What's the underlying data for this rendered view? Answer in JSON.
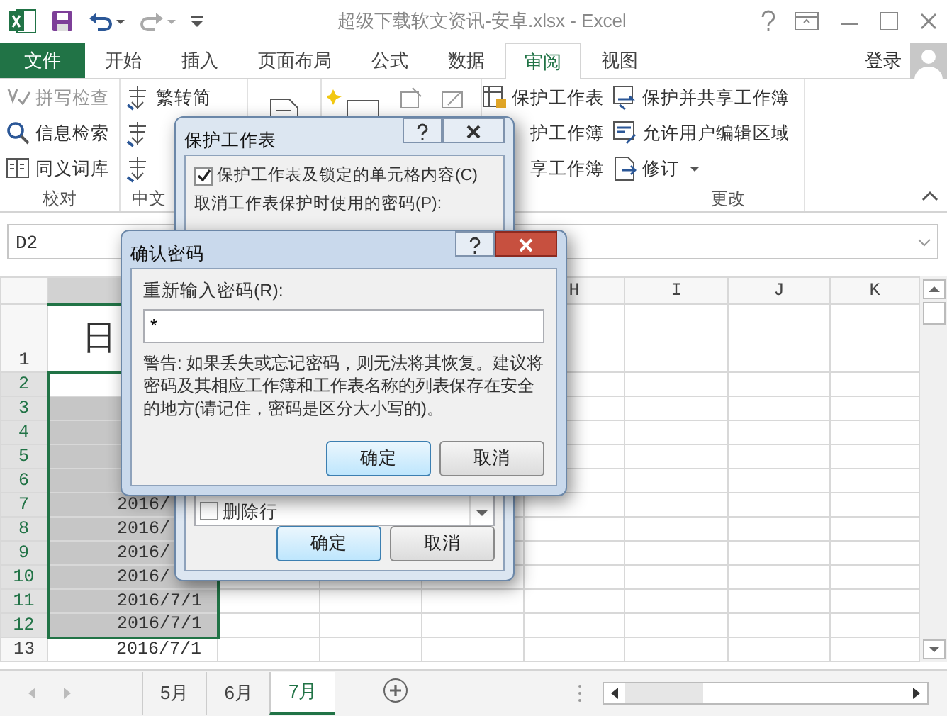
{
  "window": {
    "title": "超级下载软文资讯-安卓.xlsx - Excel"
  },
  "ribbon_tabs": [
    {
      "label": "文件",
      "kind": "file",
      "selected": false
    },
    {
      "label": "开始",
      "kind": "tab",
      "selected": false
    },
    {
      "label": "插入",
      "kind": "tab",
      "selected": false
    },
    {
      "label": "页面布局",
      "kind": "tab",
      "selected": false
    },
    {
      "label": "公式",
      "kind": "tab",
      "selected": false
    },
    {
      "label": "数据",
      "kind": "tab",
      "selected": false
    },
    {
      "label": "审阅",
      "kind": "tab",
      "selected": true
    },
    {
      "label": "视图",
      "kind": "tab",
      "selected": false
    }
  ],
  "account": {
    "label": "登录"
  },
  "ribbon_groups": [
    {
      "label": "校对",
      "items": [
        {
          "label": "拼写检查",
          "disabled": true
        },
        {
          "label": "信息检索",
          "disabled": false
        },
        {
          "label": "同义词库",
          "disabled": false
        }
      ]
    },
    {
      "label": "中文",
      "items": [
        {
          "label": "繁转简",
          "disabled": false
        }
      ]
    },
    {
      "label": "更改",
      "items": [
        {
          "label": "保护工作表",
          "disabled": false
        },
        {
          "label": "护工作簿",
          "disabled": false
        },
        {
          "label": "享工作簿",
          "disabled": false
        },
        {
          "label": "保护并共享工作簿",
          "disabled": false
        },
        {
          "label": "允许用户编辑区域",
          "disabled": false
        },
        {
          "label": "修订",
          "disabled": false
        }
      ]
    }
  ],
  "name_box": {
    "value": "D2"
  },
  "grid": {
    "columns": [
      {
        "label": "H"
      },
      {
        "label": "I"
      },
      {
        "label": "J"
      },
      {
        "label": "K"
      }
    ],
    "rows": [
      {
        "number": "1",
        "selected": false,
        "active": false,
        "cell": "日"
      },
      {
        "number": "2",
        "selected": true,
        "active": true
      },
      {
        "number": "3",
        "selected": true,
        "active": false
      },
      {
        "number": "4",
        "selected": true,
        "active": false
      },
      {
        "number": "5",
        "selected": true,
        "active": false
      },
      {
        "number": "6",
        "selected": true,
        "active": false
      },
      {
        "number": "7",
        "selected": true,
        "active": false,
        "cell": "2016/"
      },
      {
        "number": "8",
        "selected": true,
        "active": false,
        "cell": "2016/"
      },
      {
        "number": "9",
        "selected": true,
        "active": false,
        "cell": "2016/"
      },
      {
        "number": "10",
        "selected": true,
        "active": false,
        "cell": "2016/"
      },
      {
        "number": "11",
        "selected": true,
        "active": false,
        "cell": "2016/7/1"
      },
      {
        "number": "12",
        "selected": true,
        "active": false,
        "cell": "2016/7/1"
      },
      {
        "number": "13",
        "selected": false,
        "active": false,
        "cell": "2016/7/1"
      }
    ]
  },
  "sheet_tabs": [
    {
      "label": "5月",
      "selected": false
    },
    {
      "label": "6月",
      "selected": false
    },
    {
      "label": "7月",
      "selected": true
    }
  ],
  "protect_dialog": {
    "title": "保护工作表",
    "active": false,
    "checkbox": {
      "label": "保护工作表及锁定的单元格内容(C)",
      "checked": true
    },
    "password_label": "取消工作表保护时使用的密码(P):",
    "permissions": [
      {
        "label": "删除行",
        "checked": false
      }
    ],
    "buttons": [
      {
        "label": "确定",
        "default": true
      },
      {
        "label": "取消",
        "default": false
      }
    ]
  },
  "confirm_dialog": {
    "title": "确认密码",
    "active": true,
    "label": "重新输入密码(R):",
    "value": "*",
    "warning": "警告: 如果丢失或忘记密码，则无法将其恢复。建议将密码及其相应工作簿和工作表名称的列表保存在安全的地方(请记住，密码是区分大小写的)。",
    "buttons": [
      {
        "label": "确定",
        "default": true
      },
      {
        "label": "取消",
        "default": false
      }
    ]
  }
}
